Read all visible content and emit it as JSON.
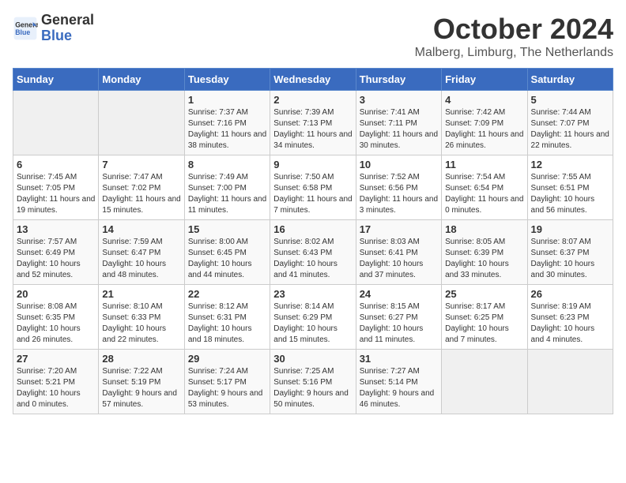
{
  "header": {
    "logo_line1": "General",
    "logo_line2": "Blue",
    "month": "October 2024",
    "location": "Malberg, Limburg, The Netherlands"
  },
  "weekdays": [
    "Sunday",
    "Monday",
    "Tuesday",
    "Wednesday",
    "Thursday",
    "Friday",
    "Saturday"
  ],
  "weeks": [
    [
      {
        "day": "",
        "info": ""
      },
      {
        "day": "",
        "info": ""
      },
      {
        "day": "1",
        "info": "Sunrise: 7:37 AM\nSunset: 7:16 PM\nDaylight: 11 hours and 38 minutes."
      },
      {
        "day": "2",
        "info": "Sunrise: 7:39 AM\nSunset: 7:13 PM\nDaylight: 11 hours and 34 minutes."
      },
      {
        "day": "3",
        "info": "Sunrise: 7:41 AM\nSunset: 7:11 PM\nDaylight: 11 hours and 30 minutes."
      },
      {
        "day": "4",
        "info": "Sunrise: 7:42 AM\nSunset: 7:09 PM\nDaylight: 11 hours and 26 minutes."
      },
      {
        "day": "5",
        "info": "Sunrise: 7:44 AM\nSunset: 7:07 PM\nDaylight: 11 hours and 22 minutes."
      }
    ],
    [
      {
        "day": "6",
        "info": "Sunrise: 7:45 AM\nSunset: 7:05 PM\nDaylight: 11 hours and 19 minutes."
      },
      {
        "day": "7",
        "info": "Sunrise: 7:47 AM\nSunset: 7:02 PM\nDaylight: 11 hours and 15 minutes."
      },
      {
        "day": "8",
        "info": "Sunrise: 7:49 AM\nSunset: 7:00 PM\nDaylight: 11 hours and 11 minutes."
      },
      {
        "day": "9",
        "info": "Sunrise: 7:50 AM\nSunset: 6:58 PM\nDaylight: 11 hours and 7 minutes."
      },
      {
        "day": "10",
        "info": "Sunrise: 7:52 AM\nSunset: 6:56 PM\nDaylight: 11 hours and 3 minutes."
      },
      {
        "day": "11",
        "info": "Sunrise: 7:54 AM\nSunset: 6:54 PM\nDaylight: 11 hours and 0 minutes."
      },
      {
        "day": "12",
        "info": "Sunrise: 7:55 AM\nSunset: 6:51 PM\nDaylight: 10 hours and 56 minutes."
      }
    ],
    [
      {
        "day": "13",
        "info": "Sunrise: 7:57 AM\nSunset: 6:49 PM\nDaylight: 10 hours and 52 minutes."
      },
      {
        "day": "14",
        "info": "Sunrise: 7:59 AM\nSunset: 6:47 PM\nDaylight: 10 hours and 48 minutes."
      },
      {
        "day": "15",
        "info": "Sunrise: 8:00 AM\nSunset: 6:45 PM\nDaylight: 10 hours and 44 minutes."
      },
      {
        "day": "16",
        "info": "Sunrise: 8:02 AM\nSunset: 6:43 PM\nDaylight: 10 hours and 41 minutes."
      },
      {
        "day": "17",
        "info": "Sunrise: 8:03 AM\nSunset: 6:41 PM\nDaylight: 10 hours and 37 minutes."
      },
      {
        "day": "18",
        "info": "Sunrise: 8:05 AM\nSunset: 6:39 PM\nDaylight: 10 hours and 33 minutes."
      },
      {
        "day": "19",
        "info": "Sunrise: 8:07 AM\nSunset: 6:37 PM\nDaylight: 10 hours and 30 minutes."
      }
    ],
    [
      {
        "day": "20",
        "info": "Sunrise: 8:08 AM\nSunset: 6:35 PM\nDaylight: 10 hours and 26 minutes."
      },
      {
        "day": "21",
        "info": "Sunrise: 8:10 AM\nSunset: 6:33 PM\nDaylight: 10 hours and 22 minutes."
      },
      {
        "day": "22",
        "info": "Sunrise: 8:12 AM\nSunset: 6:31 PM\nDaylight: 10 hours and 18 minutes."
      },
      {
        "day": "23",
        "info": "Sunrise: 8:14 AM\nSunset: 6:29 PM\nDaylight: 10 hours and 15 minutes."
      },
      {
        "day": "24",
        "info": "Sunrise: 8:15 AM\nSunset: 6:27 PM\nDaylight: 10 hours and 11 minutes."
      },
      {
        "day": "25",
        "info": "Sunrise: 8:17 AM\nSunset: 6:25 PM\nDaylight: 10 hours and 7 minutes."
      },
      {
        "day": "26",
        "info": "Sunrise: 8:19 AM\nSunset: 6:23 PM\nDaylight: 10 hours and 4 minutes."
      }
    ],
    [
      {
        "day": "27",
        "info": "Sunrise: 7:20 AM\nSunset: 5:21 PM\nDaylight: 10 hours and 0 minutes."
      },
      {
        "day": "28",
        "info": "Sunrise: 7:22 AM\nSunset: 5:19 PM\nDaylight: 9 hours and 57 minutes."
      },
      {
        "day": "29",
        "info": "Sunrise: 7:24 AM\nSunset: 5:17 PM\nDaylight: 9 hours and 53 minutes."
      },
      {
        "day": "30",
        "info": "Sunrise: 7:25 AM\nSunset: 5:16 PM\nDaylight: 9 hours and 50 minutes."
      },
      {
        "day": "31",
        "info": "Sunrise: 7:27 AM\nSunset: 5:14 PM\nDaylight: 9 hours and 46 minutes."
      },
      {
        "day": "",
        "info": ""
      },
      {
        "day": "",
        "info": ""
      }
    ]
  ]
}
